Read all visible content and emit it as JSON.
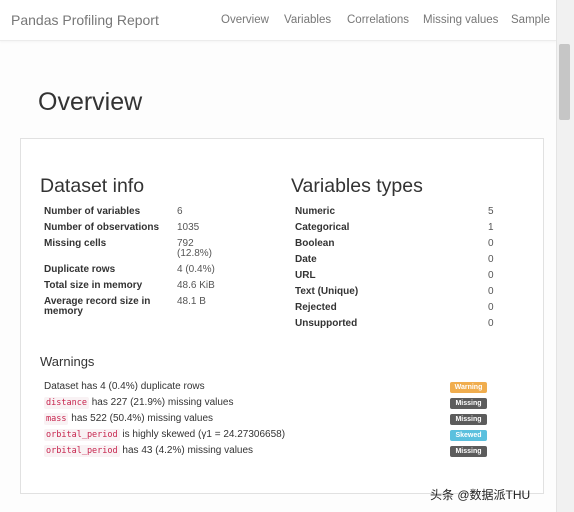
{
  "navbar": {
    "brand": "Pandas Profiling Report",
    "links": [
      "Overview",
      "Variables",
      "Correlations",
      "Missing values",
      "Sample"
    ]
  },
  "page_title": "Overview",
  "dataset_info": {
    "title": "Dataset info",
    "rows": [
      {
        "label": "Number of variables",
        "value": "6"
      },
      {
        "label": "Number of observations",
        "value": "1035"
      },
      {
        "label": "Missing cells",
        "value": "792",
        "sub": "(12.8%)"
      },
      {
        "label": "Duplicate rows",
        "value": "4 (0.4%)"
      },
      {
        "label": "Total size in memory",
        "value": "48.6 KiB"
      },
      {
        "label": "Average record size in",
        "label2": "memory",
        "value": "48.1 B"
      }
    ]
  },
  "variable_types": {
    "title": "Variables types",
    "rows": [
      {
        "label": "Numeric",
        "value": "5"
      },
      {
        "label": "Categorical",
        "value": "1"
      },
      {
        "label": "Boolean",
        "value": "0"
      },
      {
        "label": "Date",
        "value": "0"
      },
      {
        "label": "URL",
        "value": "0"
      },
      {
        "label": "Text (Unique)",
        "value": "0"
      },
      {
        "label": "Rejected",
        "value": "0"
      },
      {
        "label": "Unsupported",
        "value": "0"
      }
    ]
  },
  "warnings": {
    "title": "Warnings",
    "items": [
      {
        "prefix": "Dataset has 4 (0.4%) duplicate rows",
        "var": "",
        "text": "",
        "badge": "Warning",
        "badge_color": "#f0ad4e"
      },
      {
        "prefix": "",
        "var": "distance",
        "text": " has 227 (21.9%) missing values",
        "badge": "Missing",
        "badge_color": "#5c5c5c"
      },
      {
        "prefix": "",
        "var": "mass",
        "text": " has 522 (50.4%) missing values",
        "badge": "Missing",
        "badge_color": "#5c5c5c"
      },
      {
        "prefix": "",
        "var": "orbital_period",
        "text": " is highly skewed (γ1 = 24.27306658)",
        "badge": "Skewed",
        "badge_color": "#5bc0de"
      },
      {
        "prefix": "",
        "var": "orbital_period",
        "text": " has 43 (4.2%) missing values",
        "badge": "Missing",
        "badge_color": "#5c5c5c"
      }
    ]
  },
  "watermark": "头条 @数据派THU"
}
